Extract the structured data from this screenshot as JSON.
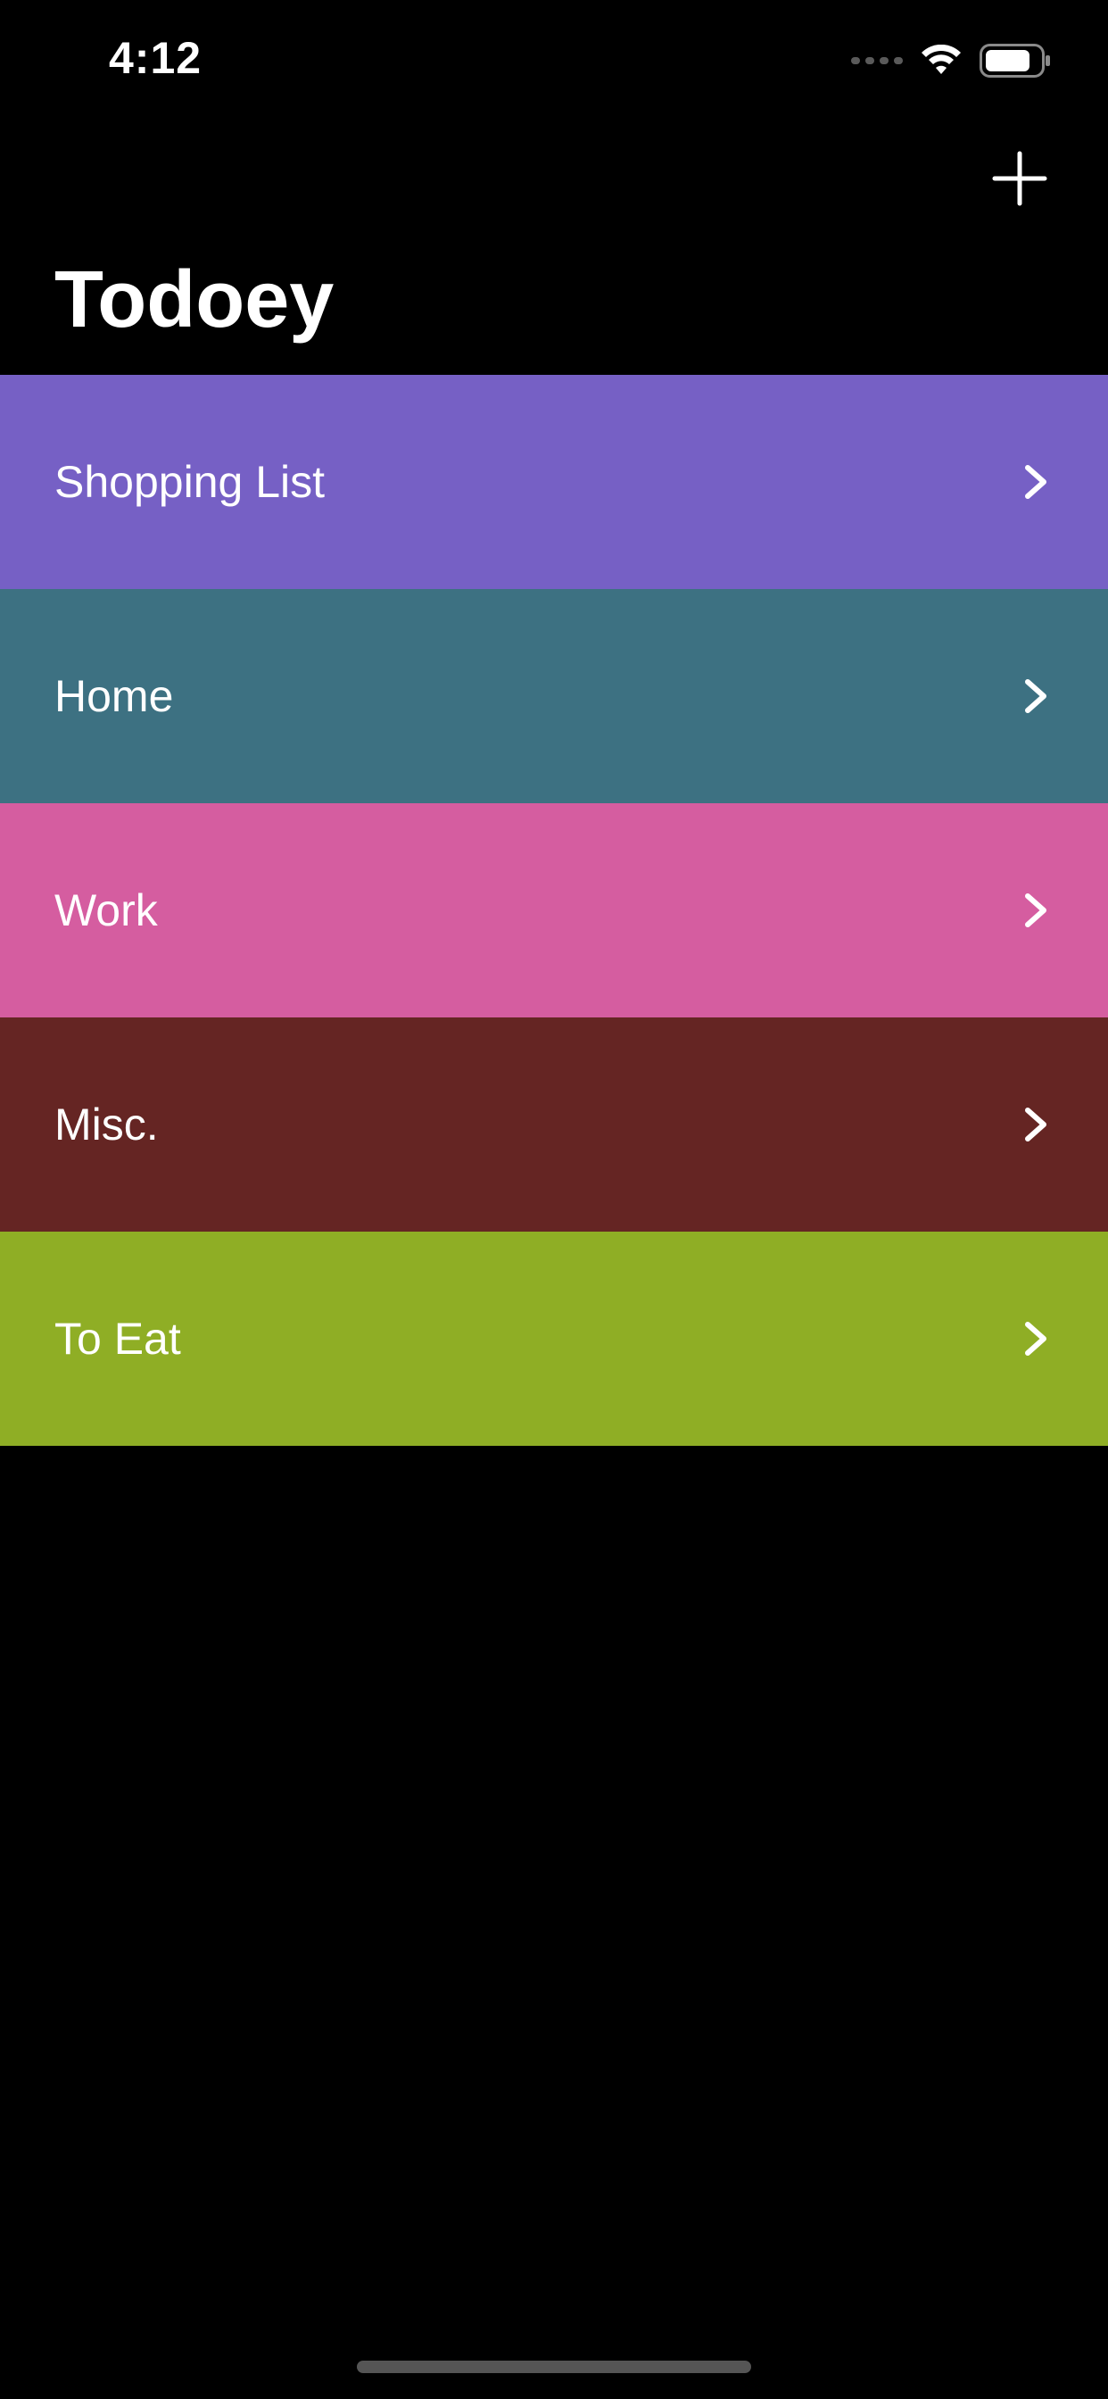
{
  "status_bar": {
    "time": "4:12",
    "icons": [
      "cellular-signal-icon",
      "wifi-icon",
      "battery-icon"
    ]
  },
  "nav_bar": {
    "title": "Todoey",
    "add_icon": "plus-icon"
  },
  "categories": [
    {
      "label": "Shopping List",
      "color": "#7660C5",
      "icon": "chevron-right-icon"
    },
    {
      "label": "Home",
      "color": "#3D7182",
      "icon": "chevron-right-icon"
    },
    {
      "label": "Work",
      "color": "#D55DA0",
      "icon": "chevron-right-icon"
    },
    {
      "label": "Misc.",
      "color": "#652523",
      "icon": "chevron-right-icon"
    },
    {
      "label": "To Eat",
      "color": "#8FAE25",
      "icon": "chevron-right-icon"
    }
  ],
  "colors": {
    "background": "#000000",
    "text": "#FFFFFF",
    "home_indicator": "#555555"
  }
}
